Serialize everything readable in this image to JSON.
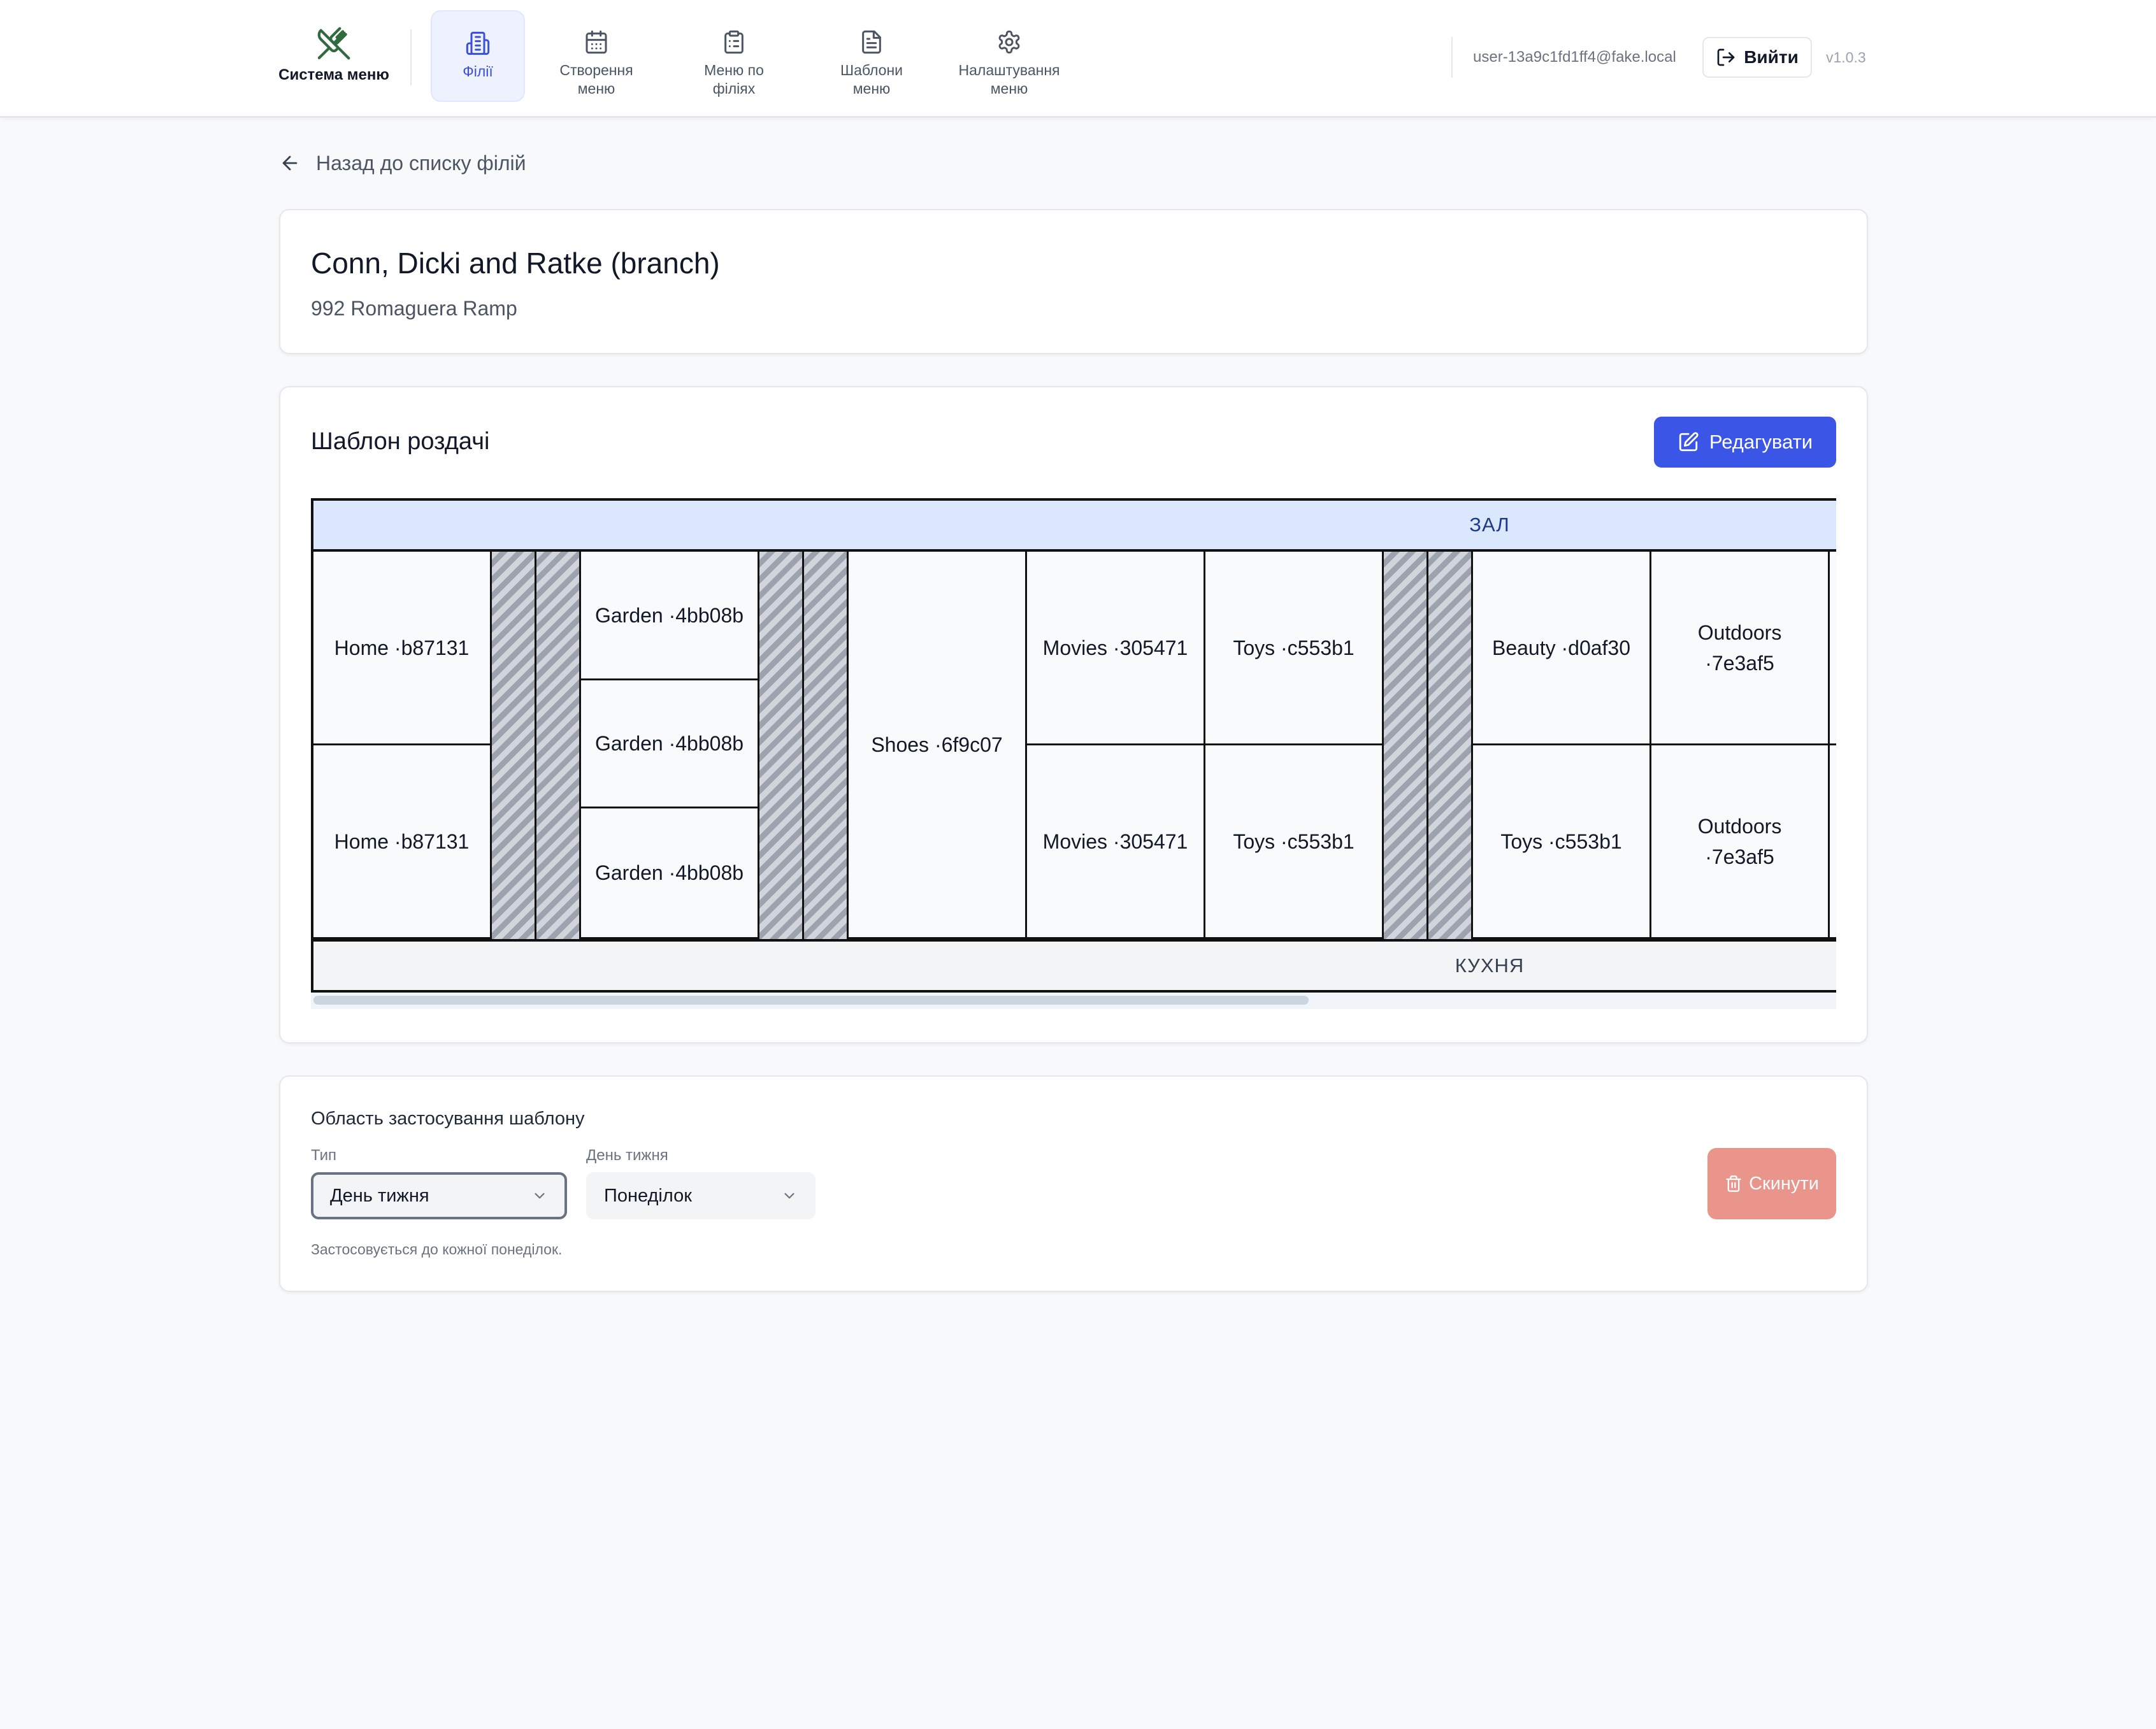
{
  "brand": {
    "name": "Система меню",
    "icon": "utensils-crossed-icon",
    "color": "#2f6b3f"
  },
  "nav": {
    "items": [
      {
        "label": "Філії",
        "icon": "building-icon",
        "active": true
      },
      {
        "label": "Створення\nменю",
        "icon": "calendar-icon",
        "active": false
      },
      {
        "label": "Меню по\nфіліях",
        "icon": "clipboard-list-icon",
        "active": false
      },
      {
        "label": "Шаблони\nменю",
        "icon": "file-text-icon",
        "active": false
      },
      {
        "label": "Налаштування\nменю",
        "icon": "gear-icon",
        "active": false
      }
    ]
  },
  "user": {
    "email": "user-13a9c1fd1ff4@fake.local",
    "logout_label": "Вийти"
  },
  "version": "v1.0.3",
  "back_link": "Назад до списку філій",
  "branch": {
    "name": "Conn, Dicki and Ratke (branch)",
    "address": "992 Romaguera Ramp"
  },
  "template": {
    "title": "Шаблон роздачі",
    "edit_label": "Редагувати",
    "hall_label": "ЗАЛ",
    "kitchen_label": "КУХНЯ",
    "cells": {
      "home_top": "Home ·b87131",
      "home_bottom": "Home ·b87131",
      "garden_1": "Garden ·4bb08b",
      "garden_2": "Garden ·4bb08b",
      "garden_3": "Garden ·4bb08b",
      "shoes": "Shoes ·6f9c07",
      "movies_top": "Movies ·305471",
      "movies_bottom": "Movies ·305471",
      "toys_top": "Toys ·c553b1",
      "toys_bottom": "Toys ·c553b1",
      "beauty": "Beauty ·d0af30",
      "toys_right": "Toys ·c553b1",
      "outdoors_top": "Outdoors ·7e3af5",
      "outdoors_bottom": "Outdoors ·7e3af5"
    }
  },
  "scope": {
    "title": "Область застосування шаблону",
    "type_label": "Тип",
    "type_value": "День тижня",
    "day_label": "День тижня",
    "day_value": "Понеділок",
    "hint": "Застосовується до кожної понеділок.",
    "reset_label": "Скинути"
  },
  "colors": {
    "accent": "#3b55e6",
    "danger": "#e9958c",
    "hall": "#dbe7fd"
  }
}
